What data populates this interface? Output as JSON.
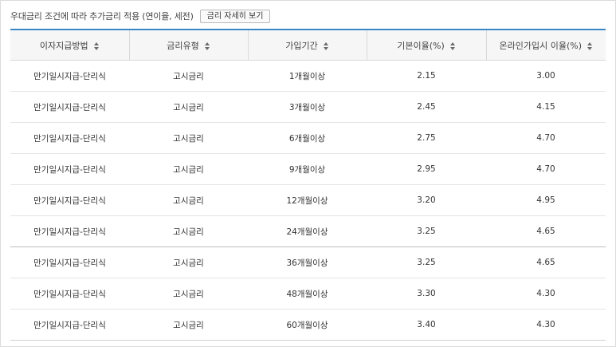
{
  "caption": "우대금리 조건에 따라 추가금리 적용 (연이율, 세전)",
  "detail_button": "금리 자세히 보기",
  "table": {
    "headers": [
      "이자지급방법",
      "금리유형",
      "가입기간",
      "기본이율(%)",
      "온라인가입시 이율(%)"
    ],
    "rows": [
      [
        "만기일시지급-단리식",
        "고시금리",
        "1개월이상",
        "2.15",
        "3.00"
      ],
      [
        "만기일시지급-단리식",
        "고시금리",
        "3개월이상",
        "2.45",
        "4.15"
      ],
      [
        "만기일시지급-단리식",
        "고시금리",
        "6개월이상",
        "2.75",
        "4.70"
      ],
      [
        "만기일시지급-단리식",
        "고시금리",
        "9개월이상",
        "2.95",
        "4.70"
      ],
      [
        "만기일시지급-단리식",
        "고시금리",
        "12개월이상",
        "3.20",
        "4.95"
      ],
      [
        "만기일시지급-단리식",
        "고시금리",
        "24개월이상",
        "3.25",
        "4.65"
      ],
      [
        "만기일시지급-단리식",
        "고시금리",
        "36개월이상",
        "3.25",
        "4.65"
      ],
      [
        "만기일시지급-단리식",
        "고시금리",
        "48개월이상",
        "3.30",
        "4.30"
      ],
      [
        "만기일시지급-단리식",
        "고시금리",
        "60개월이상",
        "3.40",
        "4.30"
      ]
    ]
  },
  "colors": {
    "accent_border": "#3a87c7",
    "header_bg": "#f6f6f6"
  }
}
